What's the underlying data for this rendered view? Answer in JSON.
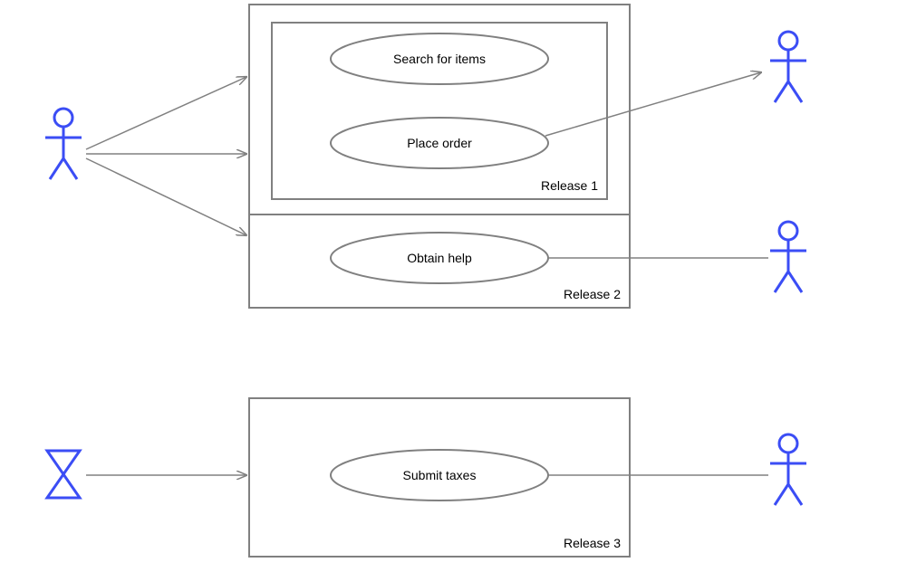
{
  "packages": {
    "release1": {
      "label": "Release 1"
    },
    "release2": {
      "label": "Release 2"
    },
    "release3": {
      "label": "Release 3"
    }
  },
  "usecases": {
    "search": {
      "label": "Search for items"
    },
    "order": {
      "label": "Place order"
    },
    "help": {
      "label": "Obtain help"
    },
    "taxes": {
      "label": "Submit taxes"
    }
  },
  "colors": {
    "actor": "#3b4df5",
    "border": "#808080",
    "text": "#000000"
  }
}
